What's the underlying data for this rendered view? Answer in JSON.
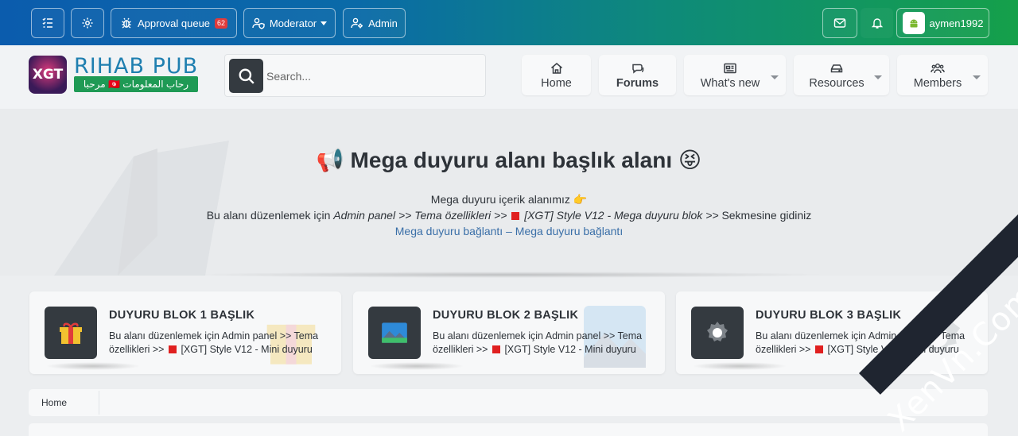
{
  "topbar": {
    "approval_label": "Approval queue",
    "approval_count": "62",
    "moderator_label": "Moderator",
    "admin_label": "Admin",
    "username": "aymen1992",
    "colors": {
      "gradient_start": "#0b5cad",
      "gradient_end": "#15a04a",
      "badge": "#e03b3b"
    }
  },
  "header": {
    "logo_text": "XGT",
    "site_title": "RIHAB PUB",
    "site_subtitle": "مرحبا 🇹🇳 رحاب المعلومات",
    "search_placeholder": "Search...",
    "nav": [
      {
        "label": "Home",
        "icon": "home-icon"
      },
      {
        "label": "Forums",
        "icon": "chat-icon",
        "active": true
      },
      {
        "label": "What's new",
        "icon": "newspaper-icon"
      },
      {
        "label": "Resources",
        "icon": "drive-icon"
      },
      {
        "label": "Members",
        "icon": "users-icon"
      }
    ]
  },
  "announcement": {
    "title_prefix_icon": "📢",
    "title": "Mega duyuru alanı başlık alanı",
    "title_suffix_icon": "😝",
    "line1": "Mega duyuru içerik alanımız 👉",
    "line2_prefix": "Bu alanı düzenlemek için",
    "line2_path": "Admin panel >> Tema özellikleri >>",
    "line2_block": "[XGT] Style V12 - Mega duyuru blok >>",
    "line2_suffix": "Sekmesine gidiniz",
    "link1": "Mega duyuru bağlantı",
    "link_sep": "–",
    "link2": "Mega duyuru bağlantı"
  },
  "blocks": [
    {
      "title": "DUYURU BLOK 1 BAŞLIK",
      "text_a": "Bu alanı düzenlemek için Admin panel >> Tema özellikleri >>",
      "text_b": "[XGT] Style V12 - Mini duyuru",
      "icon": "gift-icon"
    },
    {
      "title": "DUYURU BLOK 2 BAŞLIK",
      "text_a": "Bu alanı düzenlemek için Admin panel >> Tema özellikleri >>",
      "text_b": "[XGT] Style V12 - Mini duyuru",
      "icon": "landscape-icon"
    },
    {
      "title": "DUYURU BLOK 3 BAŞLIK",
      "text_a": "Bu alanı düzenlemek için Admin panel >> Tema özellikleri >>",
      "text_b": "[XGT] Style V12 - Mini duyuru",
      "icon": "gear-icon"
    }
  ],
  "breadcrumb": {
    "home": "Home"
  },
  "watermark": "XenVn.Com"
}
